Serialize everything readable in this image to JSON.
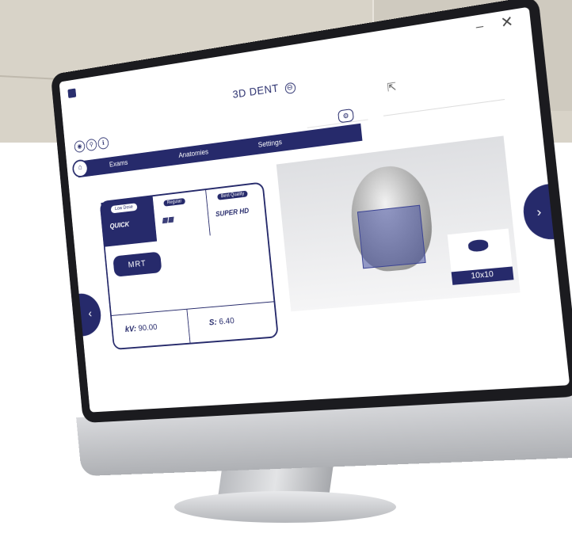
{
  "window": {
    "minimize": "–",
    "close": "✕"
  },
  "app": {
    "title": "3D DENT",
    "title_icon": "⊖"
  },
  "header_buttons": [
    "◉",
    "⚲",
    "ℹ"
  ],
  "header_fields": {
    "search": "",
    "sub": ""
  },
  "tabs": [
    {
      "label": "Exams"
    },
    {
      "label": "Anatomies"
    },
    {
      "label": "Settings",
      "active": true
    }
  ],
  "settings_icon": "⚙",
  "home_icon": "⌂",
  "modes": [
    {
      "tag": "Low Dose",
      "name": "QUICK",
      "active": true
    },
    {
      "tag": "Regular",
      "name": "▦▦",
      "active": false
    },
    {
      "tag": "Best Quality",
      "name": "SUPER HD",
      "active": false
    }
  ],
  "mrt_button": "MRT",
  "params": {
    "kv": "kV:",
    "kv_value": "90.00",
    "s": "S:",
    "s_value": "6.40"
  },
  "fov": {
    "label": "10x10"
  },
  "nav": {
    "prev": "‹",
    "next": "›"
  },
  "colors": {
    "accent": "#262a6b"
  }
}
